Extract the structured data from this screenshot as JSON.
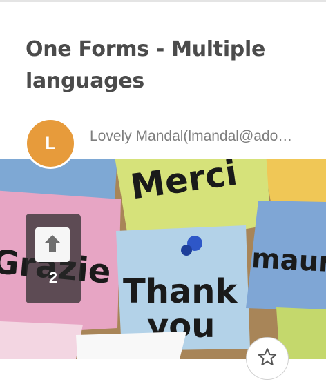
{
  "card": {
    "title": "One Forms - Multiple languages",
    "avatar_initial": "L",
    "author": "Lovely Mandal(lmandal@ado…",
    "image_notes": {
      "merci": "Merci",
      "grazie": "Grazie",
      "thank": "Thank",
      "you": "you",
      "mauru": "mauru"
    },
    "votes": "2",
    "icons": {
      "vote": "upvote-arrow-icon",
      "favorite": "star-icon"
    },
    "colors": {
      "title": "#4b4b4b",
      "avatar": "#e79b3b",
      "author": "#7e7e7e"
    }
  }
}
